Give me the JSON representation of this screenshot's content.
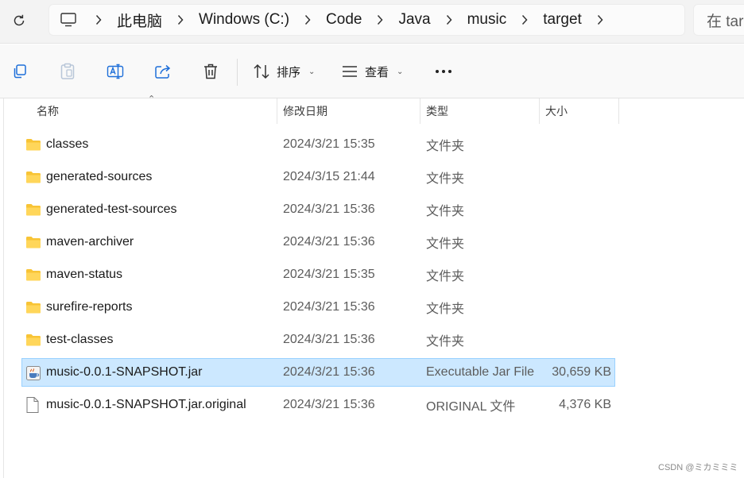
{
  "address": {
    "crumbs": [
      "此电脑",
      "Windows (C:)",
      "Code",
      "Java",
      "music",
      "target"
    ],
    "search_placeholder": "在 targ"
  },
  "toolbar": {
    "sort_label": "排序",
    "view_label": "查看"
  },
  "columns": {
    "name": "名称",
    "date": "修改日期",
    "type": "类型",
    "size": "大小"
  },
  "files": [
    {
      "name": "classes",
      "date": "2024/3/21 15:35",
      "type": "文件夹",
      "size": "",
      "kind": "folder"
    },
    {
      "name": "generated-sources",
      "date": "2024/3/15 21:44",
      "type": "文件夹",
      "size": "",
      "kind": "folder"
    },
    {
      "name": "generated-test-sources",
      "date": "2024/3/21 15:36",
      "type": "文件夹",
      "size": "",
      "kind": "folder"
    },
    {
      "name": "maven-archiver",
      "date": "2024/3/21 15:36",
      "type": "文件夹",
      "size": "",
      "kind": "folder"
    },
    {
      "name": "maven-status",
      "date": "2024/3/21 15:35",
      "type": "文件夹",
      "size": "",
      "kind": "folder"
    },
    {
      "name": "surefire-reports",
      "date": "2024/3/21 15:36",
      "type": "文件夹",
      "size": "",
      "kind": "folder"
    },
    {
      "name": "test-classes",
      "date": "2024/3/21 15:36",
      "type": "文件夹",
      "size": "",
      "kind": "folder"
    },
    {
      "name": "music-0.0.1-SNAPSHOT.jar",
      "date": "2024/3/21 15:36",
      "type": "Executable Jar File",
      "size": "30,659 KB",
      "kind": "jar",
      "selected": true
    },
    {
      "name": "music-0.0.1-SNAPSHOT.jar.original",
      "date": "2024/3/21 15:36",
      "type": "ORIGINAL 文件",
      "size": "4,376 KB",
      "kind": "file"
    }
  ],
  "watermark": "CSDN @ミカミミミ",
  "colors": {
    "selection_bg": "#cce8ff",
    "selection_border": "#99d1ff",
    "folder": "#f8c436"
  }
}
